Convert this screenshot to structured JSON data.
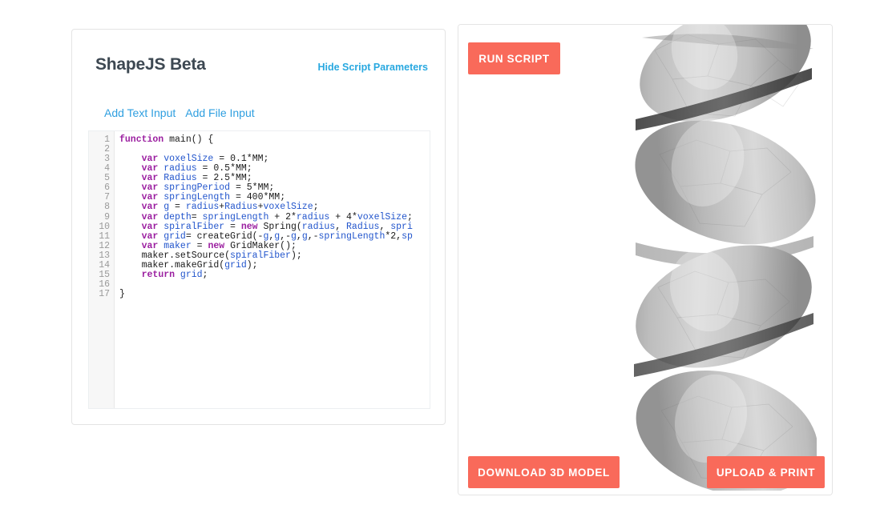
{
  "app": {
    "title": "ShapeJS Beta"
  },
  "editor_panel": {
    "toggle_params_link": "Hide Script Parameters",
    "input_links": [
      {
        "label": "Add Text Input",
        "name": "add-text-input-link"
      },
      {
        "label": "Add File Input",
        "name": "add-file-input-link"
      }
    ],
    "code": {
      "line_numbers": [
        "1",
        "2",
        "3",
        "4",
        "5",
        "6",
        "7",
        "8",
        "9",
        "10",
        "11",
        "12",
        "13",
        "14",
        "15",
        "16",
        "17"
      ],
      "lines": [
        [
          {
            "t": "function ",
            "c": "kw"
          },
          {
            "t": "main() {",
            "c": "pln"
          }
        ],
        [],
        [
          {
            "t": "    ",
            "c": "pln"
          },
          {
            "t": "var ",
            "c": "kw"
          },
          {
            "t": "voxelSize",
            "c": "var"
          },
          {
            "t": " = ",
            "c": "pln"
          },
          {
            "t": "0.1",
            "c": "num"
          },
          {
            "t": "*",
            "c": "pln"
          },
          {
            "t": "MM",
            "c": "pln"
          },
          {
            "t": ";",
            "c": "pln"
          }
        ],
        [
          {
            "t": "    ",
            "c": "pln"
          },
          {
            "t": "var ",
            "c": "kw"
          },
          {
            "t": "radius",
            "c": "var"
          },
          {
            "t": " = ",
            "c": "pln"
          },
          {
            "t": "0.5",
            "c": "num"
          },
          {
            "t": "*",
            "c": "pln"
          },
          {
            "t": "MM",
            "c": "pln"
          },
          {
            "t": ";",
            "c": "pln"
          }
        ],
        [
          {
            "t": "    ",
            "c": "pln"
          },
          {
            "t": "var ",
            "c": "kw"
          },
          {
            "t": "Radius",
            "c": "var"
          },
          {
            "t": " = ",
            "c": "pln"
          },
          {
            "t": "2.5",
            "c": "num"
          },
          {
            "t": "*",
            "c": "pln"
          },
          {
            "t": "MM",
            "c": "pln"
          },
          {
            "t": ";",
            "c": "pln"
          }
        ],
        [
          {
            "t": "    ",
            "c": "pln"
          },
          {
            "t": "var ",
            "c": "kw"
          },
          {
            "t": "springPeriod",
            "c": "var"
          },
          {
            "t": " = ",
            "c": "pln"
          },
          {
            "t": "5",
            "c": "num"
          },
          {
            "t": "*",
            "c": "pln"
          },
          {
            "t": "MM",
            "c": "pln"
          },
          {
            "t": ";",
            "c": "pln"
          }
        ],
        [
          {
            "t": "    ",
            "c": "pln"
          },
          {
            "t": "var ",
            "c": "kw"
          },
          {
            "t": "springLength",
            "c": "var"
          },
          {
            "t": " = ",
            "c": "pln"
          },
          {
            "t": "400",
            "c": "num"
          },
          {
            "t": "*",
            "c": "pln"
          },
          {
            "t": "MM",
            "c": "pln"
          },
          {
            "t": ";",
            "c": "pln"
          }
        ],
        [
          {
            "t": "    ",
            "c": "pln"
          },
          {
            "t": "var ",
            "c": "kw"
          },
          {
            "t": "g",
            "c": "var"
          },
          {
            "t": " = ",
            "c": "pln"
          },
          {
            "t": "radius",
            "c": "var"
          },
          {
            "t": "+",
            "c": "pln"
          },
          {
            "t": "Radius",
            "c": "var"
          },
          {
            "t": "+",
            "c": "pln"
          },
          {
            "t": "voxelSize",
            "c": "var"
          },
          {
            "t": ";",
            "c": "pln"
          }
        ],
        [
          {
            "t": "    ",
            "c": "pln"
          },
          {
            "t": "var ",
            "c": "kw"
          },
          {
            "t": "depth",
            "c": "var"
          },
          {
            "t": "= ",
            "c": "pln"
          },
          {
            "t": "springLength",
            "c": "var"
          },
          {
            "t": " + ",
            "c": "pln"
          },
          {
            "t": "2",
            "c": "num"
          },
          {
            "t": "*",
            "c": "pln"
          },
          {
            "t": "radius",
            "c": "var"
          },
          {
            "t": " + ",
            "c": "pln"
          },
          {
            "t": "4",
            "c": "num"
          },
          {
            "t": "*",
            "c": "pln"
          },
          {
            "t": "voxelSize",
            "c": "var"
          },
          {
            "t": ";",
            "c": "pln"
          }
        ],
        [
          {
            "t": "    ",
            "c": "pln"
          },
          {
            "t": "var ",
            "c": "kw"
          },
          {
            "t": "spiralFiber",
            "c": "var"
          },
          {
            "t": " = ",
            "c": "pln"
          },
          {
            "t": "new ",
            "c": "kw"
          },
          {
            "t": "Spring(",
            "c": "pln"
          },
          {
            "t": "radius",
            "c": "var"
          },
          {
            "t": ", ",
            "c": "pln"
          },
          {
            "t": "Radius",
            "c": "var"
          },
          {
            "t": ", ",
            "c": "pln"
          },
          {
            "t": "spri",
            "c": "var"
          }
        ],
        [
          {
            "t": "    ",
            "c": "pln"
          },
          {
            "t": "var ",
            "c": "kw"
          },
          {
            "t": "grid",
            "c": "var"
          },
          {
            "t": "= ",
            "c": "pln"
          },
          {
            "t": "createGrid(-",
            "c": "pln"
          },
          {
            "t": "g",
            "c": "var"
          },
          {
            "t": ",",
            "c": "pln"
          },
          {
            "t": "g",
            "c": "var"
          },
          {
            "t": ",-",
            "c": "pln"
          },
          {
            "t": "g",
            "c": "var"
          },
          {
            "t": ",",
            "c": "pln"
          },
          {
            "t": "g",
            "c": "var"
          },
          {
            "t": ",-",
            "c": "pln"
          },
          {
            "t": "springLength",
            "c": "var"
          },
          {
            "t": "*",
            "c": "pln"
          },
          {
            "t": "2",
            "c": "num"
          },
          {
            "t": ",",
            "c": "pln"
          },
          {
            "t": "sp",
            "c": "var"
          }
        ],
        [
          {
            "t": "    ",
            "c": "pln"
          },
          {
            "t": "var ",
            "c": "kw"
          },
          {
            "t": "maker",
            "c": "var"
          },
          {
            "t": " = ",
            "c": "pln"
          },
          {
            "t": "new ",
            "c": "kw"
          },
          {
            "t": "GridMaker();",
            "c": "pln"
          }
        ],
        [
          {
            "t": "    ",
            "c": "pln"
          },
          {
            "t": "maker",
            "c": "pln"
          },
          {
            "t": ".setSource(",
            "c": "pln"
          },
          {
            "t": "spiralFiber",
            "c": "var"
          },
          {
            "t": ");",
            "c": "pln"
          }
        ],
        [
          {
            "t": "    ",
            "c": "pln"
          },
          {
            "t": "maker",
            "c": "pln"
          },
          {
            "t": ".makeGrid(",
            "c": "pln"
          },
          {
            "t": "grid",
            "c": "var"
          },
          {
            "t": ");",
            "c": "pln"
          }
        ],
        [
          {
            "t": "    ",
            "c": "pln"
          },
          {
            "t": "return ",
            "c": "kw"
          },
          {
            "t": "grid",
            "c": "var"
          },
          {
            "t": ";",
            "c": "pln"
          }
        ],
        [],
        [
          {
            "t": "}",
            "c": "pln"
          }
        ]
      ]
    }
  },
  "viewer_panel": {
    "run_button": "RUN SCRIPT",
    "download_button": "DOWNLOAD 3D MODEL",
    "upload_button": "UPLOAD & PRINT",
    "model": {
      "description": "faceted gray 3D helix spiral fiber",
      "shape": "spring"
    }
  },
  "colors": {
    "accent_button": "#f96a5a",
    "link_blue": "#2f9fe0",
    "title_gray": "#3d4852",
    "card_border": "#e4e4e4",
    "gutter_bg": "#f7f7f7",
    "model_gray": "#b5b5b5"
  }
}
